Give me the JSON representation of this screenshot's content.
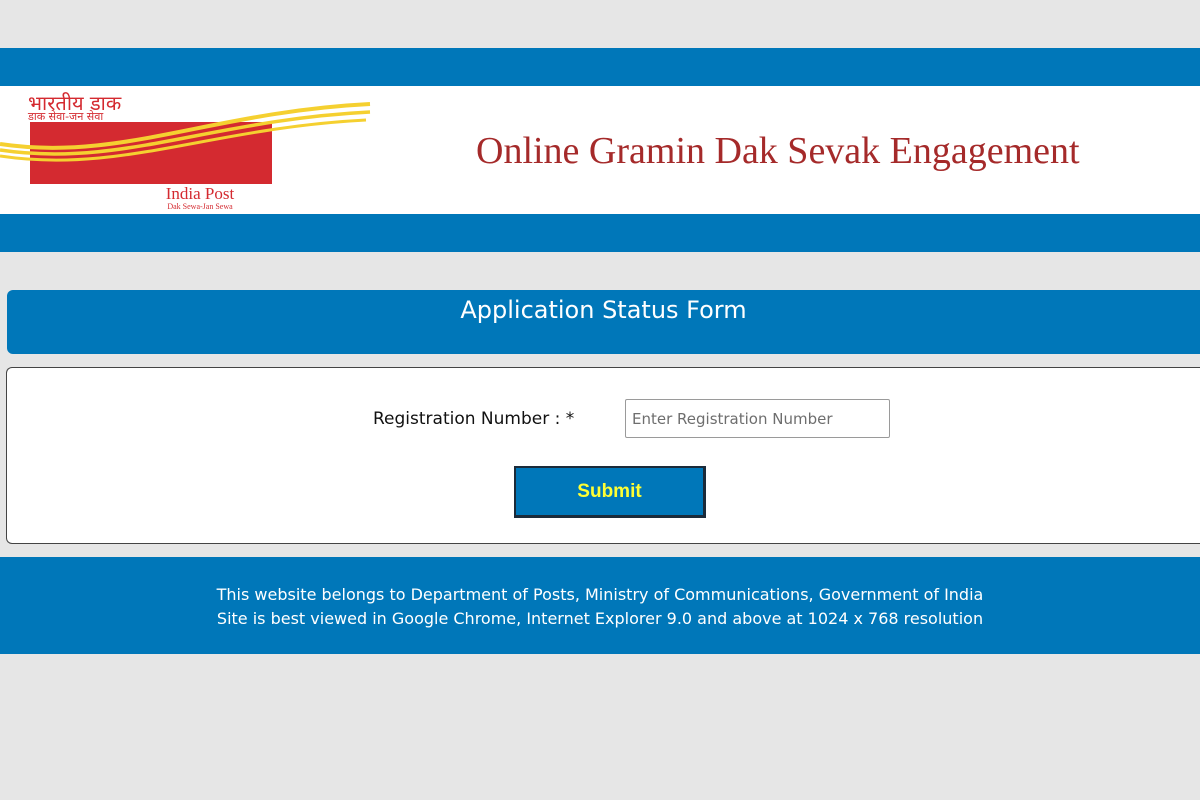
{
  "colors": {
    "brand_blue": "#0077b9",
    "title_red": "#a52a2a",
    "logo_red": "#d42a30",
    "logo_yellow": "#f5d030",
    "submit_text": "#ffff33"
  },
  "header": {
    "logo": {
      "hindi_title": "भारतीय डाक",
      "hindi_tagline": "डाक सेवा-जन सेवा",
      "brand_name": "India Post",
      "tagline": "Dak Sewa-Jan Sewa"
    },
    "site_title": "Online Gramin Dak Sevak Engagement"
  },
  "form": {
    "title": "Application Status Form",
    "registration_label": "Registration Number : *",
    "registration_value": "",
    "registration_placeholder": "Enter Registration Number",
    "submit_label": "Submit"
  },
  "footer": {
    "line1": "This website belongs to Department of Posts, Ministry of Communications, Government of India",
    "line2": "Site is best viewed in Google Chrome, Internet Explorer 9.0 and above at 1024 x 768 resolution"
  }
}
